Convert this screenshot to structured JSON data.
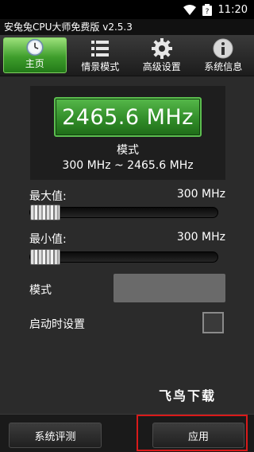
{
  "status_bar": {
    "time": "11:20"
  },
  "app": {
    "title": "安兔兔CPU大师免费版 v2.5.3"
  },
  "tabs": [
    {
      "label": "主页",
      "icon": "clock-icon",
      "active": true
    },
    {
      "label": "情景模式",
      "icon": "list-icon",
      "active": false
    },
    {
      "label": "高级设置",
      "icon": "gear-icon",
      "active": false
    },
    {
      "label": "系统信息",
      "icon": "info-icon",
      "active": false
    }
  ],
  "frequency": {
    "current": "2465.6 MHz",
    "mode_label": "模式",
    "range": "300 MHz ~ 2465.6 MHz"
  },
  "max": {
    "label": "最大值:",
    "value": "300 MHz",
    "slider_fraction": 0.0
  },
  "min": {
    "label": "最小值:",
    "value": "300 MHz",
    "slider_fraction": 0.0
  },
  "mode_row": {
    "label": "模式",
    "value": ""
  },
  "boot_row": {
    "label": "启动时设置",
    "checked": false
  },
  "watermark": "飞鸟下载",
  "bottom": {
    "benchmark_label": "系统评测",
    "apply_label": "应用"
  },
  "colors": {
    "accent_green": "#3f9e2c",
    "highlight_red": "#d91a1a"
  }
}
